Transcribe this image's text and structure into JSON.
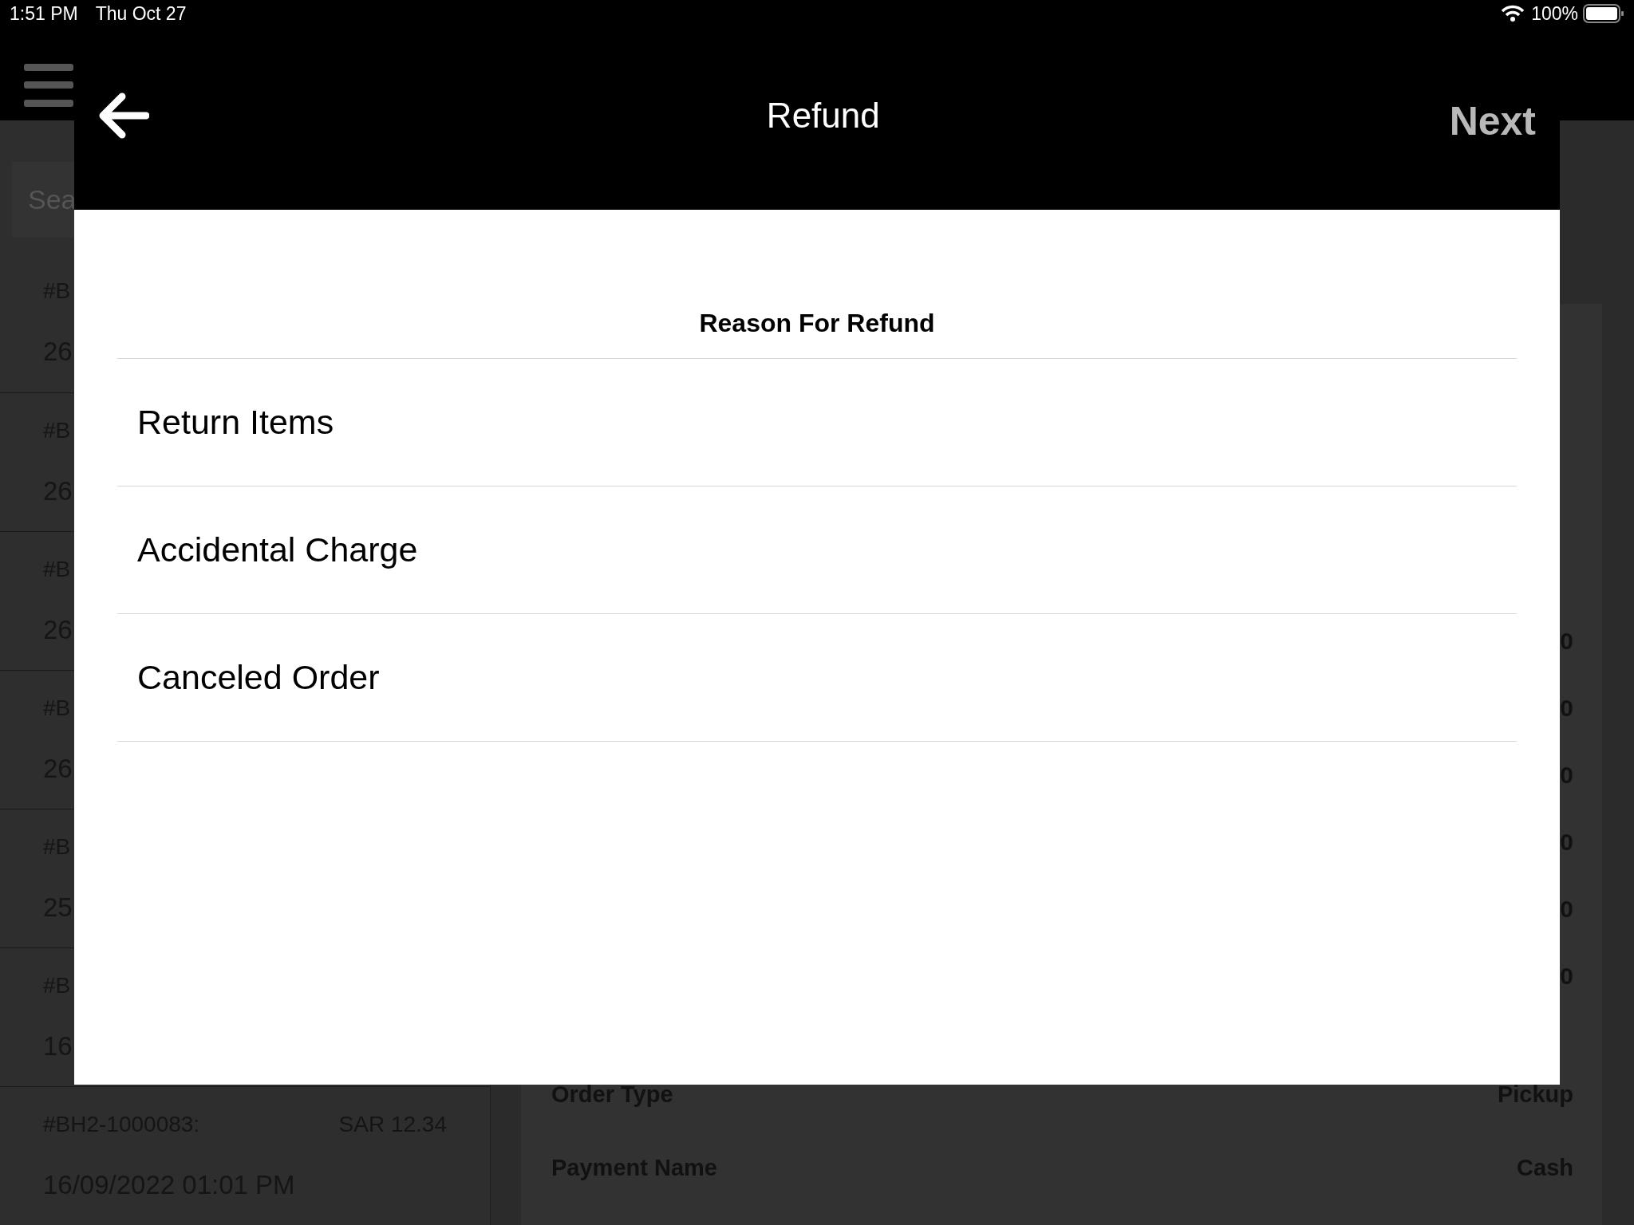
{
  "status_bar": {
    "time": "1:51 PM",
    "date": "Thu Oct 27",
    "battery": "100%"
  },
  "search": {
    "placeholder": "Sea"
  },
  "orders": [
    {
      "number": "#B",
      "date": "26"
    },
    {
      "number": "#B",
      "date": "26"
    },
    {
      "number": "#B",
      "date": "26"
    },
    {
      "number": "#B",
      "date": "26"
    },
    {
      "number": "#B",
      "date": "25"
    },
    {
      "number": "#B",
      "date": "16"
    },
    {
      "number": "#BH2-1000083:",
      "amount": "SAR 12.34",
      "date": "16/09/2022 01:01 PM"
    }
  ],
  "details": {
    "values": [
      "0",
      "0",
      "0",
      "0",
      "0",
      "0"
    ],
    "rows": [
      {
        "label": "Order Type",
        "value": "Pickup"
      },
      {
        "label": "Payment Name",
        "value": "Cash"
      }
    ]
  },
  "dialog": {
    "title": "Refund",
    "next": "Next",
    "heading": "Reason For Refund",
    "reasons": [
      "Return Items",
      "Accidental Charge",
      "Canceled Order"
    ]
  }
}
